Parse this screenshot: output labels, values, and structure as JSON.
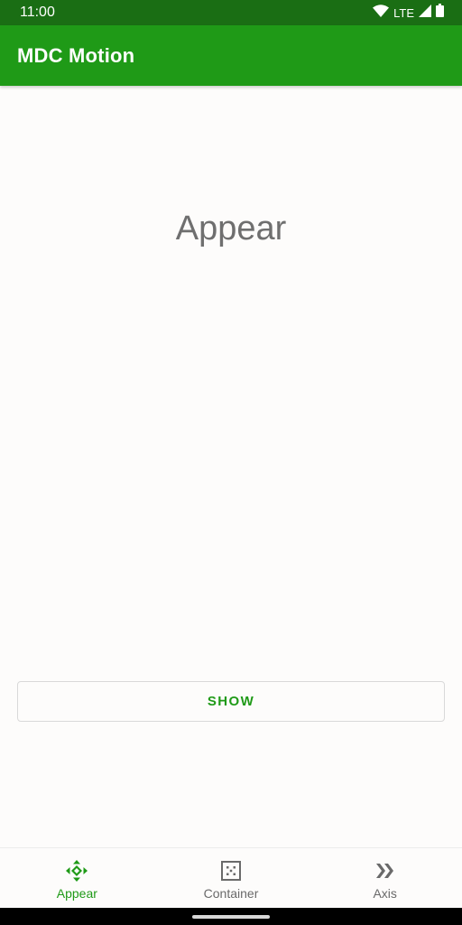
{
  "status_bar": {
    "time": "11:00",
    "network": "LTE"
  },
  "app_bar": {
    "title": "MDC Motion"
  },
  "main": {
    "heading": "Appear",
    "show_button_label": "SHOW"
  },
  "bottom_nav": {
    "items": [
      {
        "label": "Appear",
        "icon": "appear-icon",
        "active": true
      },
      {
        "label": "Container",
        "icon": "container-icon",
        "active": false
      },
      {
        "label": "Axis",
        "icon": "axis-icon",
        "active": false
      }
    ]
  },
  "colors": {
    "status_bar_bg": "#1a6e14",
    "app_bar_bg": "#1f9a17",
    "accent": "#1f9a17",
    "heading_text": "#6f6f6f",
    "inactive_nav": "#6a6a6a",
    "background": "#fdfcfb"
  }
}
